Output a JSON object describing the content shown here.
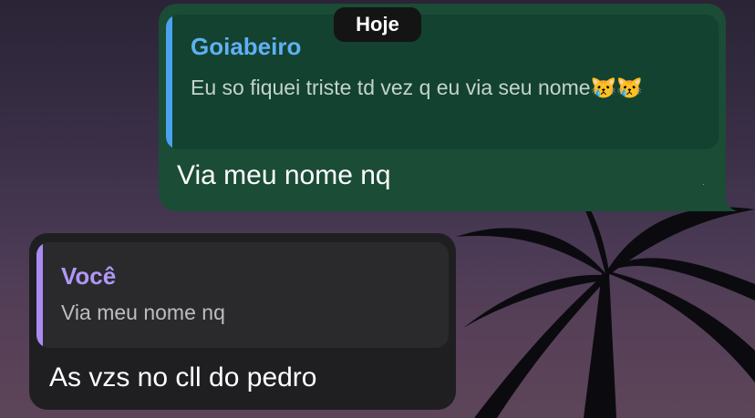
{
  "date_chip": {
    "label": "Hoje"
  },
  "messages": [
    {
      "direction": "outgoing",
      "reply": {
        "sender": "Goiabeiro",
        "text": "Eu so fiquei triste td vez q eu via seu nome😿😿"
      },
      "text": "Via meu nome nq"
    },
    {
      "direction": "incoming",
      "reply": {
        "sender": "Você",
        "text": "Via meu nome nq"
      },
      "text": "As vzs no cll do pedro"
    }
  ],
  "colors": {
    "outgoing_bubble": "#1a4c36",
    "outgoing_reply_bar": "#4aa3f0",
    "incoming_bubble": "#1f1f21",
    "incoming_reply_bar": "#a98cf2"
  }
}
